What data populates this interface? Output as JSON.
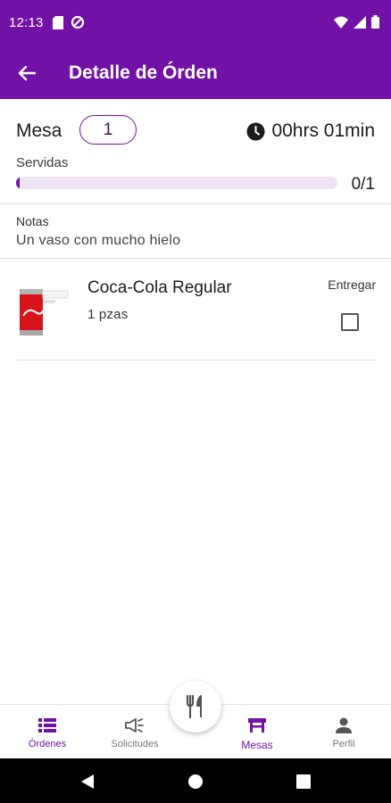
{
  "status_bar": {
    "time": "12:13",
    "left_icons": [
      "sd-card-icon",
      "data-saver-icon"
    ],
    "right_icons": [
      "wifi-icon",
      "signal-icon",
      "battery-icon"
    ]
  },
  "app_bar": {
    "title": "Detalle de Órden",
    "back_icon": "arrow-back-icon"
  },
  "order": {
    "table_label": "Mesa",
    "table_number": "1",
    "timer_icon": "clock-icon",
    "elapsed": "00hrs 01min",
    "served_label": "Servidas",
    "served_progress": 0.0,
    "served_count": "0/1",
    "notes_label": "Notas",
    "notes_text": "Un vaso con mucho hielo"
  },
  "items": [
    {
      "name": "Coca-Cola Regular",
      "quantity": "1 pzas",
      "deliver_label": "Entregar",
      "delivered": false
    }
  ],
  "bottom_nav": {
    "items": [
      {
        "label": "Órdenes",
        "icon": "list-icon",
        "active": false
      },
      {
        "label": "Solicitudes",
        "icon": "megaphone-icon",
        "active": false
      },
      {
        "label": "Mesas",
        "icon": "table-icon",
        "active": true
      },
      {
        "label": "Perfil",
        "icon": "person-icon",
        "active": false
      }
    ],
    "fab_icon": "fork-knife-icon"
  },
  "colors": {
    "primary": "#7211a6",
    "progress_track": "#ede3f5",
    "inactive_nav": "#777777"
  }
}
